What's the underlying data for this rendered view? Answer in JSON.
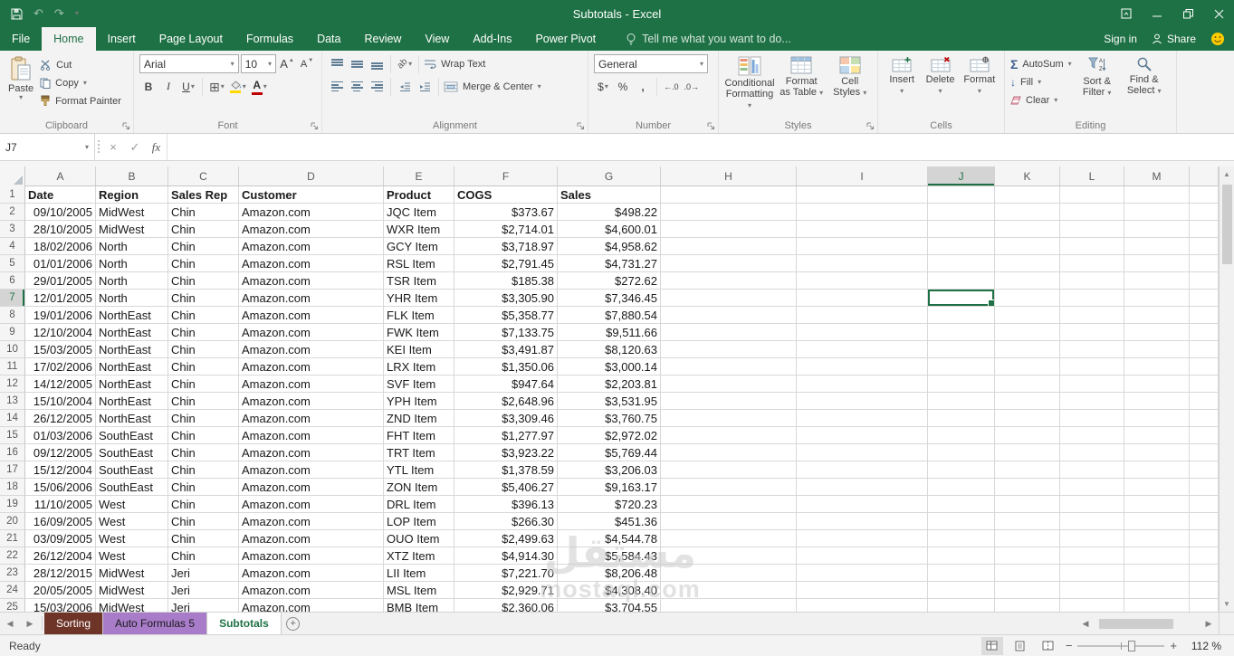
{
  "title_bar": {
    "title": "Subtotals - Excel"
  },
  "active_tab": "Home",
  "ribbon_tabs": [
    "File",
    "Home",
    "Insert",
    "Page Layout",
    "Formulas",
    "Data",
    "Review",
    "View",
    "Add-Ins",
    "Power Pivot"
  ],
  "tell_me": "Tell me what you want to do...",
  "account": {
    "sign_in": "Sign in",
    "share": "Share"
  },
  "ribbon": {
    "clipboard": {
      "label": "Clipboard",
      "paste": "Paste",
      "cut": "Cut",
      "copy": "Copy",
      "format_painter": "Format Painter"
    },
    "font": {
      "label": "Font",
      "family": "Arial",
      "size": "10"
    },
    "alignment": {
      "label": "Alignment",
      "wrap_text": "Wrap Text",
      "merge_center": "Merge & Center"
    },
    "number": {
      "label": "Number",
      "format": "General"
    },
    "styles": {
      "label": "Styles",
      "conditional_formatting": "Conditional Formatting",
      "format_as_table": "Format as Table",
      "cell_styles": "Cell Styles"
    },
    "cells": {
      "label": "Cells",
      "insert": "Insert",
      "delete": "Delete",
      "format": "Format"
    },
    "editing": {
      "label": "Editing",
      "autosum": "AutoSum",
      "fill": "Fill",
      "clear": "Clear",
      "sort_filter": "Sort & Filter",
      "find_select": "Find & Select"
    }
  },
  "formula_bar": {
    "name_box": "J7",
    "fx": "fx"
  },
  "grid": {
    "columns": [
      "A",
      "B",
      "C",
      "D",
      "E",
      "F",
      "G",
      "H",
      "I",
      "J",
      "K",
      "L",
      "M"
    ],
    "selected_column": "J",
    "selected_row": 7,
    "selected_cell": "J7",
    "header_row": [
      "Date",
      "Region",
      "Sales Rep",
      "Customer",
      "Product",
      "COGS",
      "Sales"
    ],
    "data_rows": [
      [
        "09/10/2005",
        "MidWest",
        "Chin",
        "Amazon.com",
        "JQC Item",
        "$373.67",
        "$498.22"
      ],
      [
        "28/10/2005",
        "MidWest",
        "Chin",
        "Amazon.com",
        "WXR Item",
        "$2,714.01",
        "$4,600.01"
      ],
      [
        "18/02/2006",
        "North",
        "Chin",
        "Amazon.com",
        "GCY Item",
        "$3,718.97",
        "$4,958.62"
      ],
      [
        "01/01/2006",
        "North",
        "Chin",
        "Amazon.com",
        "RSL Item",
        "$2,791.45",
        "$4,731.27"
      ],
      [
        "29/01/2005",
        "North",
        "Chin",
        "Amazon.com",
        "TSR Item",
        "$185.38",
        "$272.62"
      ],
      [
        "12/01/2005",
        "North",
        "Chin",
        "Amazon.com",
        "YHR Item",
        "$3,305.90",
        "$7,346.45"
      ],
      [
        "19/01/2006",
        "NorthEast",
        "Chin",
        "Amazon.com",
        "FLK Item",
        "$5,358.77",
        "$7,880.54"
      ],
      [
        "12/10/2004",
        "NorthEast",
        "Chin",
        "Amazon.com",
        "FWK Item",
        "$7,133.75",
        "$9,511.66"
      ],
      [
        "15/03/2005",
        "NorthEast",
        "Chin",
        "Amazon.com",
        "KEI Item",
        "$3,491.87",
        "$8,120.63"
      ],
      [
        "17/02/2006",
        "NorthEast",
        "Chin",
        "Amazon.com",
        "LRX Item",
        "$1,350.06",
        "$3,000.14"
      ],
      [
        "14/12/2005",
        "NorthEast",
        "Chin",
        "Amazon.com",
        "SVF Item",
        "$947.64",
        "$2,203.81"
      ],
      [
        "15/10/2004",
        "NorthEast",
        "Chin",
        "Amazon.com",
        "YPH Item",
        "$2,648.96",
        "$3,531.95"
      ],
      [
        "26/12/2005",
        "NorthEast",
        "Chin",
        "Amazon.com",
        "ZND Item",
        "$3,309.46",
        "$3,760.75"
      ],
      [
        "01/03/2006",
        "SouthEast",
        "Chin",
        "Amazon.com",
        "FHT Item",
        "$1,277.97",
        "$2,972.02"
      ],
      [
        "09/12/2005",
        "SouthEast",
        "Chin",
        "Amazon.com",
        "TRT Item",
        "$3,923.22",
        "$5,769.44"
      ],
      [
        "15/12/2004",
        "SouthEast",
        "Chin",
        "Amazon.com",
        "YTL Item",
        "$1,378.59",
        "$3,206.03"
      ],
      [
        "15/06/2006",
        "SouthEast",
        "Chin",
        "Amazon.com",
        "ZON Item",
        "$5,406.27",
        "$9,163.17"
      ],
      [
        "11/10/2005",
        "West",
        "Chin",
        "Amazon.com",
        "DRL Item",
        "$396.13",
        "$720.23"
      ],
      [
        "16/09/2005",
        "West",
        "Chin",
        "Amazon.com",
        "LOP Item",
        "$266.30",
        "$451.36"
      ],
      [
        "03/09/2005",
        "West",
        "Chin",
        "Amazon.com",
        "OUO Item",
        "$2,499.63",
        "$4,544.78"
      ],
      [
        "26/12/2004",
        "West",
        "Chin",
        "Amazon.com",
        "XTZ Item",
        "$4,914.30",
        "$5,584.43"
      ],
      [
        "28/12/2015",
        "MidWest",
        "Jeri",
        "Amazon.com",
        "LII Item",
        "$7,221.70",
        "$8,206.48"
      ],
      [
        "20/05/2005",
        "MidWest",
        "Jeri",
        "Amazon.com",
        "MSL Item",
        "$2,929.71",
        "$4,308.40"
      ],
      [
        "15/03/2006",
        "MidWest",
        "Jeri",
        "Amazon.com",
        "BMB Item",
        "$2,360.06",
        "$3,704.55"
      ]
    ]
  },
  "sheet_tabs": [
    {
      "label": "Sorting",
      "bg": "#6e3428",
      "fg": "#ffffff",
      "active": false
    },
    {
      "label": "Auto Formulas 5",
      "bg": "#a87cc9",
      "fg": "#1a1a1a",
      "active": false
    },
    {
      "label": "Subtotals",
      "bg": "#ffffff",
      "fg": "#1e7145",
      "active": true
    }
  ],
  "status_bar": {
    "mode": "Ready",
    "zoom": "112 %"
  },
  "watermark": {
    "line1": "مستقل",
    "line2": "mostaql.com"
  },
  "colors": {
    "accent": "#1e7145",
    "title_bar": "#1e7145",
    "sorting_tab": "#6e3428",
    "auto_formulas_tab": "#a87cc9",
    "fill_color_swatch": "#ffd800",
    "font_color_swatch": "#c00000"
  },
  "icons": {
    "dropdown": "▾",
    "up": "▲",
    "down": "▼",
    "left": "◀",
    "right": "▶",
    "close": "×",
    "check": "✓",
    "sigma": "Σ",
    "borders": "⊞",
    "fill_down": "↓",
    "bold": "B",
    "italic": "I",
    "underline": "U",
    "font_a": "A",
    "currency": "$",
    "percent": "%",
    "comma": ",",
    "inc_decimal": "←.0",
    "dec_decimal": ".0→",
    "plus": "+",
    "minus": "−",
    "undo": "↶",
    "redo": "↷",
    "orientation": "ab"
  }
}
